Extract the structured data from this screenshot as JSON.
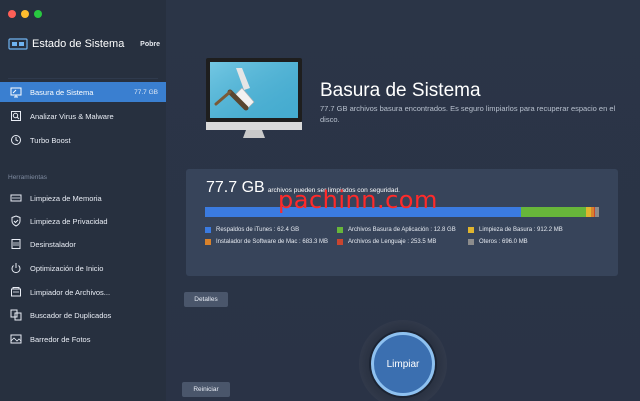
{
  "window": {
    "traffic_colors": [
      "#fe5f57",
      "#febc2e",
      "#28c840"
    ]
  },
  "app": {
    "title": "Estado de Sistema",
    "status": "Pobre"
  },
  "sidebar": {
    "items": [
      {
        "label": "Basura de Sistema",
        "size": "77.7 GB",
        "icon": "monitor-icon",
        "active": true
      },
      {
        "label": "Analizar Virus & Malware",
        "icon": "shield-scan-icon"
      },
      {
        "label": "Turbo Boost",
        "icon": "rocket-icon"
      }
    ],
    "section_label": "Herramientas",
    "tools": [
      {
        "label": "Limpieza de Memoria",
        "icon": "memory-icon"
      },
      {
        "label": "Limpieza de Privacidad",
        "icon": "privacy-shield-icon"
      },
      {
        "label": "Desinstalador",
        "icon": "trash-icon"
      },
      {
        "label": "Optimización de Inicio",
        "icon": "power-icon"
      },
      {
        "label": "Limpiador de Archivos...",
        "icon": "files-icon"
      },
      {
        "label": "Buscador de Duplicados",
        "icon": "duplicates-icon"
      },
      {
        "label": "Barredor de Fotos",
        "icon": "photo-icon"
      }
    ]
  },
  "hero": {
    "title": "Basura de Sistema",
    "description": "77.7 GB archivos basura encontrados. Es seguro limpiarlos para recuperar espacio en el disco."
  },
  "summary": {
    "total": "77.7 GB",
    "total_desc": "archivos pueden ser limpiados con seguridad.",
    "categories": [
      {
        "label": "Respaldos de iTunes : 62.4 GB",
        "color": "#3b7be0",
        "gb": 62.4
      },
      {
        "label": "Archivos Basura de Aplicación : 12.8 GB",
        "color": "#67b63a",
        "gb": 12.8
      },
      {
        "label": "Limpieza de Basura : 912.2 MB",
        "color": "#e0b52e",
        "gb": 0.912
      },
      {
        "label": "Instalador de Software de Mac : 683.3 MB",
        "color": "#d9822b",
        "gb": 0.683
      },
      {
        "label": "Archivos de Lenguaje : 253.5 MB",
        "color": "#c9452f",
        "gb": 0.254
      },
      {
        "label": "Oteros : 696.0 MB",
        "color": "#8c8c8c",
        "gb": 0.696
      }
    ]
  },
  "watermark": "pachinn.com",
  "buttons": {
    "details": "Detalles",
    "clean": "Limpiar",
    "restart": "Reiniciar"
  }
}
